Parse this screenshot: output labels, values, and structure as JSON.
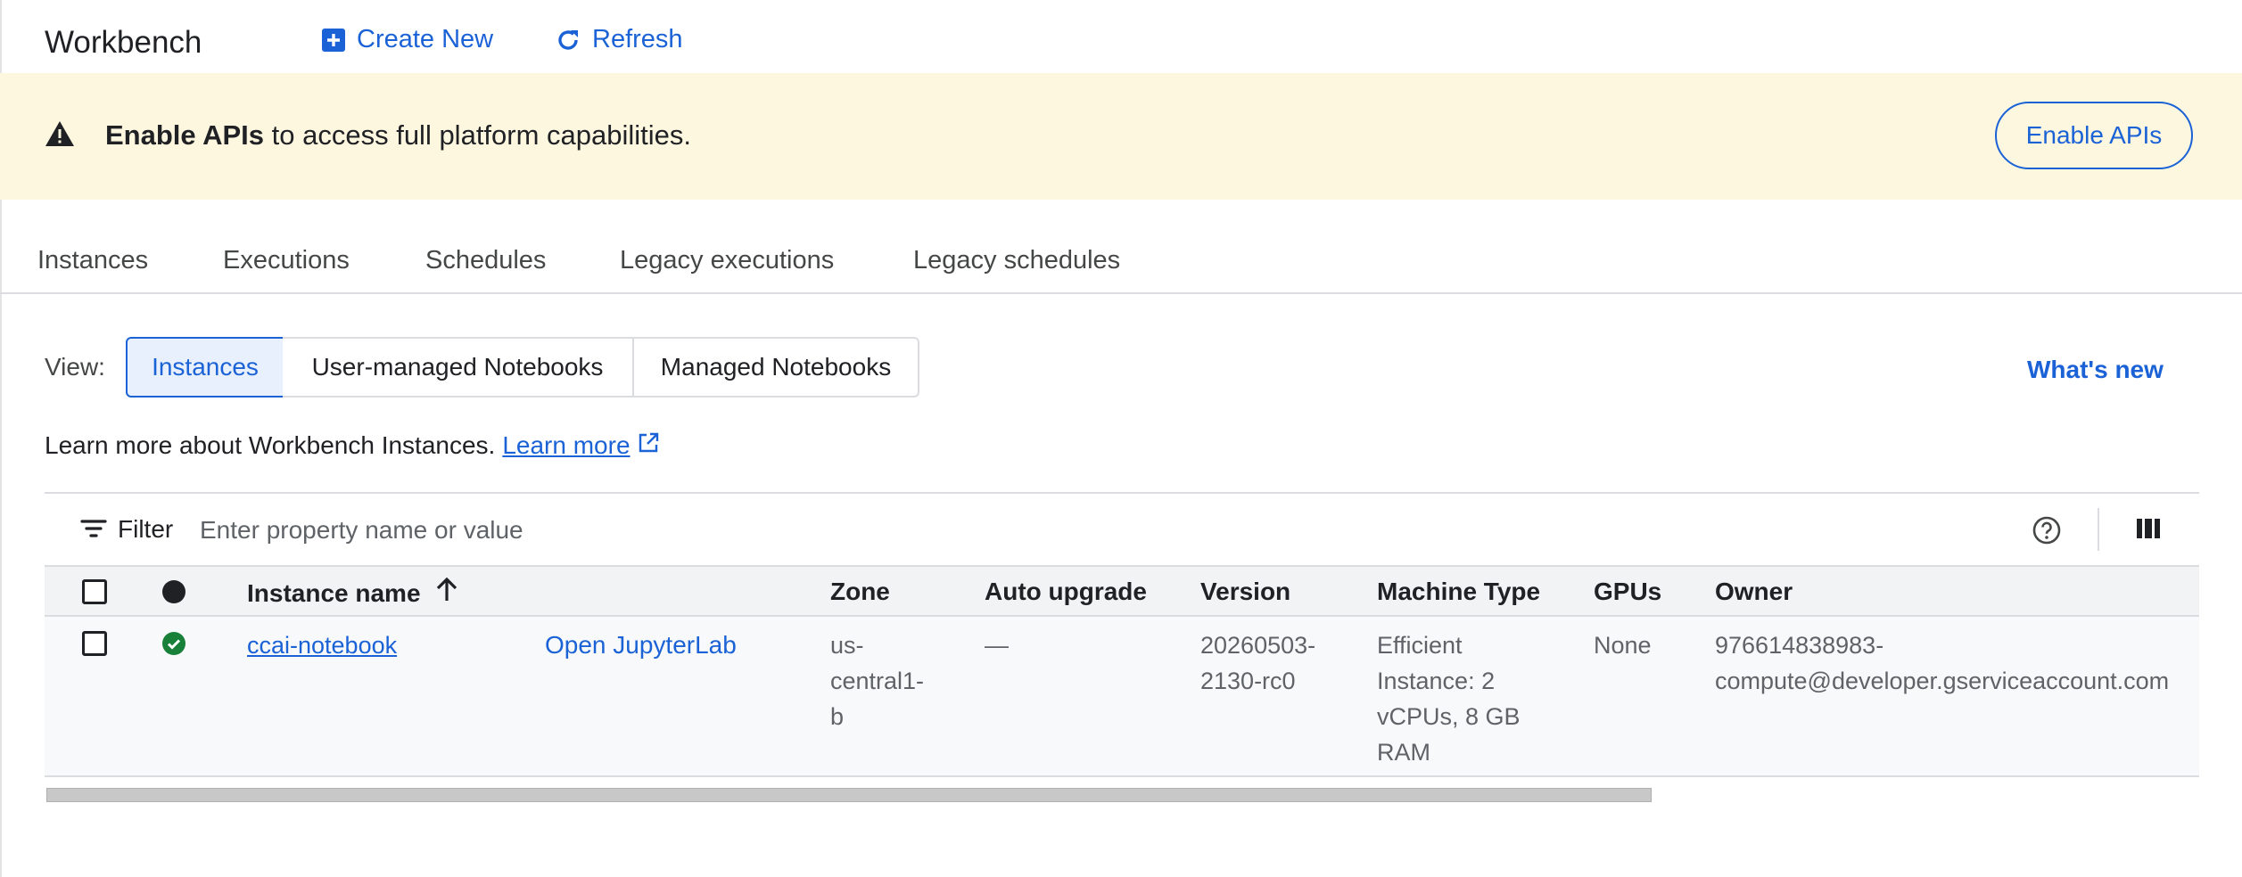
{
  "header": {
    "title": "Workbench",
    "create_new": "Create New",
    "refresh": "Refresh"
  },
  "banner": {
    "bold": "Enable APIs",
    "text": " to access full platform capabilities.",
    "button": "Enable APIs",
    "icon": "warning-icon",
    "background": "#fef7e0"
  },
  "tabs": [
    "Instances",
    "Executions",
    "Schedules",
    "Legacy executions",
    "Legacy schedules"
  ],
  "view": {
    "label": "View:",
    "options": [
      "Instances",
      "User-managed Notebooks",
      "Managed Notebooks"
    ],
    "selected": "Instances",
    "whats_new": "What's new"
  },
  "learn": {
    "text": "Learn more about Workbench Instances.",
    "link": "Learn more"
  },
  "filter": {
    "label": "Filter",
    "placeholder": "Enter property name or value"
  },
  "table": {
    "columns": {
      "name": "Instance name",
      "zone": "Zone",
      "auto_upgrade": "Auto upgrade",
      "version": "Version",
      "machine_type": "Machine Type",
      "gpus": "GPUs",
      "owner": "Owner"
    },
    "sort": "ascending by Instance name",
    "rows": [
      {
        "status": "running",
        "name": "ccai-notebook",
        "action": "Open JupyterLab",
        "zone_lines": [
          "us-",
          "central1-",
          "b"
        ],
        "auto_upgrade": "—",
        "version_lines": [
          "20260503-",
          "2130-rc0"
        ],
        "machine_lines": [
          "Efficient",
          "Instance: 2",
          "vCPUs, 8 GB",
          "RAM"
        ],
        "gpus": "None",
        "owner_lines": [
          "976614838983-",
          "compute@developer.gserviceaccount.com"
        ]
      }
    ]
  },
  "colors": {
    "accent": "#1a62d6",
    "status_ok": "#188038"
  }
}
